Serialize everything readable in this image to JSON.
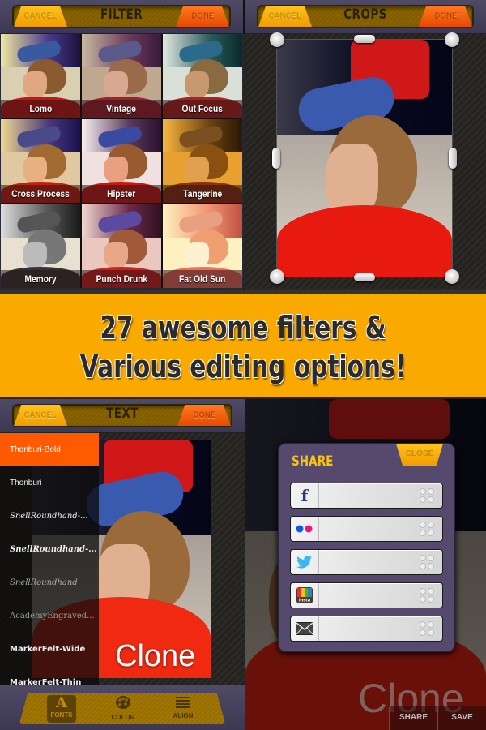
{
  "filter_panel": {
    "title": "FILTER",
    "cancel_label": "CANCEL",
    "done_label": "DONE",
    "filters": [
      {
        "name": "Lomo"
      },
      {
        "name": "Vintage"
      },
      {
        "name": "Out Focus"
      },
      {
        "name": "Cross Process"
      },
      {
        "name": "Hipster"
      },
      {
        "name": "Tangerine"
      },
      {
        "name": "Memory"
      },
      {
        "name": "Punch Drunk"
      },
      {
        "name": "Fat Old Sun"
      }
    ]
  },
  "crops_panel": {
    "title": "CROPS",
    "cancel_label": "CANCEL",
    "done_label": "DONE"
  },
  "banner": {
    "line1": "27 awesome filters &",
    "line2": "Various editing options!"
  },
  "text_panel": {
    "title": "TEXT",
    "cancel_label": "CANCEL",
    "done_label": "DONE",
    "overlay_text": "Clone",
    "fonts": [
      {
        "name": "Thonburi-Bold",
        "selected": true
      },
      {
        "name": "Thonburi"
      },
      {
        "name": "SnellRoundhand-..."
      },
      {
        "name": "SnellRoundhand-..."
      },
      {
        "name": "SnellRoundhand"
      },
      {
        "name": "AcademyEngraved..."
      },
      {
        "name": "MarkerFelt-Wide"
      },
      {
        "name": "MarkerFelt-Thin"
      }
    ],
    "tools": [
      {
        "label": "FONTS",
        "icon": "A",
        "active": true
      },
      {
        "label": "COLOR",
        "icon": "palette"
      },
      {
        "label": "ALIGN",
        "icon": "align-lines"
      }
    ]
  },
  "share_panel": {
    "title": "SHARE",
    "close_label": "CLOSE",
    "services": [
      {
        "name": "facebook",
        "icon": "f"
      },
      {
        "name": "flickr",
        "icon": "flickr-dots"
      },
      {
        "name": "twitter",
        "icon": "bird"
      },
      {
        "name": "instagram",
        "icon": "Insta"
      },
      {
        "name": "email",
        "icon": "envelope"
      }
    ],
    "footer": {
      "share_label": "SHARE",
      "save_label": "SAVE"
    },
    "ghost_text": "Clone"
  },
  "colors": {
    "accent_orange": "#f9a900",
    "done_red": "#e64a00",
    "share_title": "#f7c411",
    "modal_bg": "#554a6e",
    "active_font": "#ff5a00"
  }
}
